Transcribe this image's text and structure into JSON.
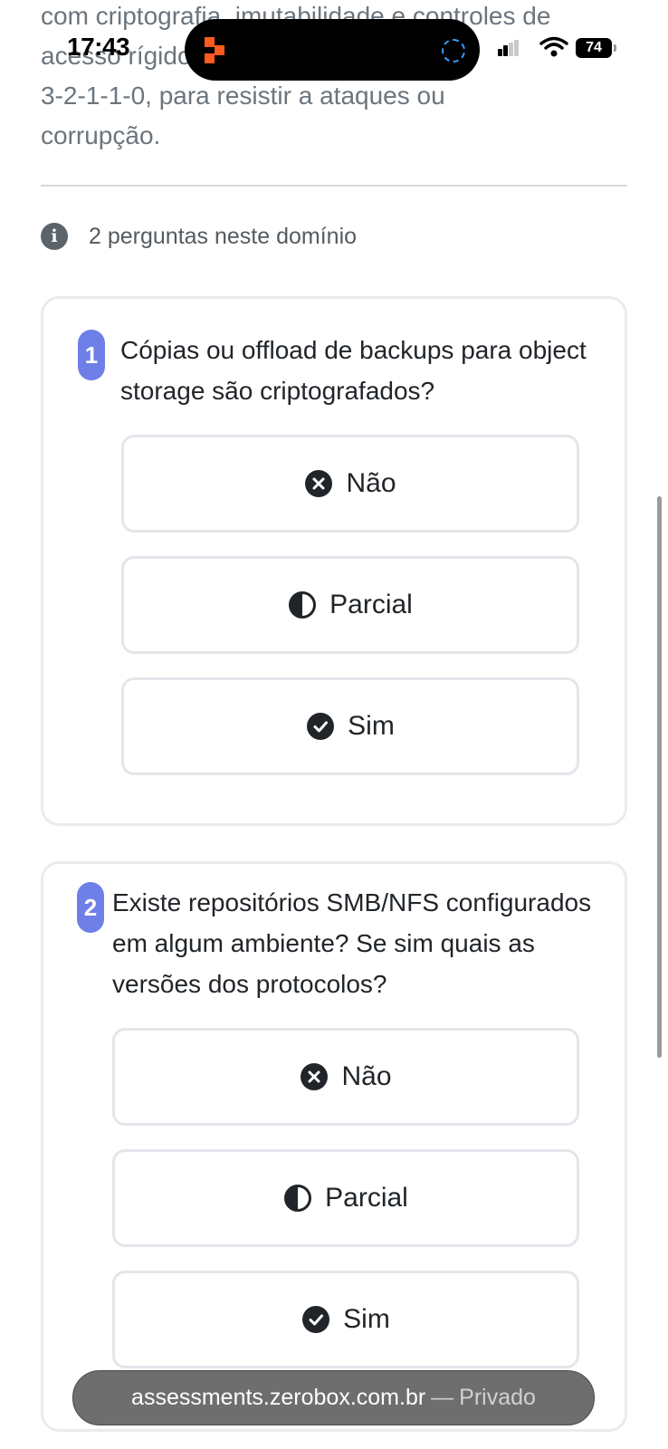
{
  "status_bar": {
    "time": "17:43",
    "battery": "74"
  },
  "intro": {
    "lines": [
      "com criptografia, imutabilidade e controles de",
      "acesso rígidos, seguindo a regra",
      "3-2-1-1-0, para resistir a ataques ou",
      "corrupção."
    ]
  },
  "info": {
    "text": "2 perguntas neste domínio",
    "icon": "info-circle-icon"
  },
  "questions": [
    {
      "number": "1",
      "text": "Cópias ou offload de backups para object storage são criptografados?",
      "options": [
        {
          "label": "Não",
          "icon": "x-circle-icon"
        },
        {
          "label": "Parcial",
          "icon": "half-circle-icon"
        },
        {
          "label": "Sim",
          "icon": "check-circle-icon"
        }
      ]
    },
    {
      "number": "2",
      "text": "Existe repositórios SMB/NFS configurados em algum ambiente? Se sim quais as versões dos protocolos?",
      "options": [
        {
          "label": "Não",
          "icon": "x-circle-icon"
        },
        {
          "label": "Parcial",
          "icon": "half-circle-icon"
        },
        {
          "label": "Sim",
          "icon": "check-circle-icon"
        }
      ]
    }
  ],
  "browser": {
    "domain": "assessments.zerobox.com.br",
    "separator": "—",
    "mode": "Privado"
  },
  "colors": {
    "accent": "#6f7fe8",
    "icon_dark": "#212529",
    "muted_text": "#6c757d"
  }
}
